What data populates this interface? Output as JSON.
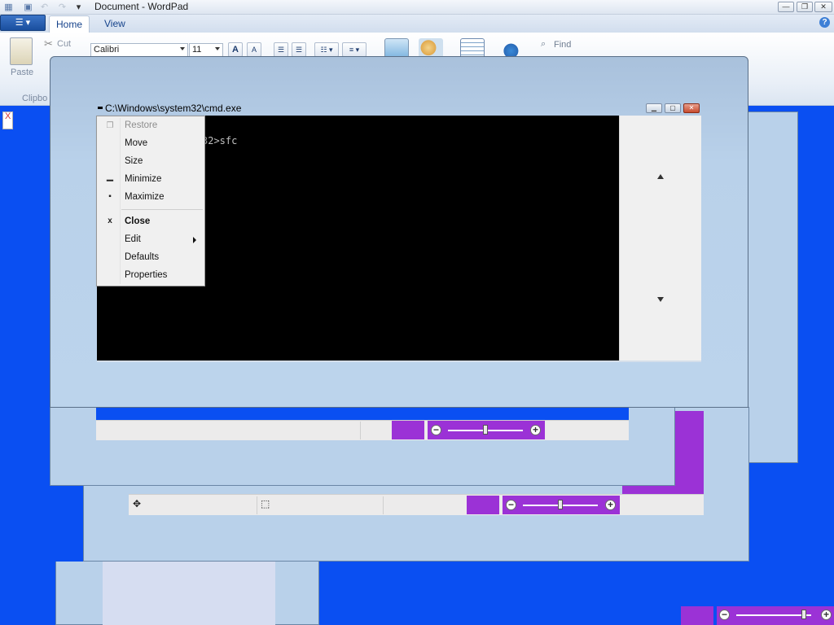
{
  "wordpad": {
    "title": "Document - WordPad",
    "tabs": [
      {
        "label": "Home"
      },
      {
        "label": "View"
      }
    ],
    "app_menu_label": "☰ ▾",
    "help_label": "?",
    "window_controls": {
      "minimize": "—",
      "restore": "❐",
      "close": "✕"
    },
    "clipboard": {
      "paste_label": "Paste",
      "cut_label": "Cut",
      "group_label": "Clipbo"
    },
    "font": {
      "family": "Calibri",
      "size": "11"
    },
    "editing": {
      "find_label": "Find"
    },
    "grow_font_label": "A",
    "shrink_font_label": "A",
    "ruler_mark": "X"
  },
  "cmd": {
    "title": "C:\\Windows\\system32\\cmd.exe",
    "console_text": "32>sfc",
    "controls": {
      "minimize": "▁",
      "maximize": "▢",
      "close": "✕"
    }
  },
  "system_menu": {
    "items": [
      {
        "label": "Restore",
        "icon": "❐",
        "disabled": true
      },
      {
        "label": "Move"
      },
      {
        "label": "Size"
      },
      {
        "label": "Minimize",
        "icon": "▁"
      },
      {
        "label": "Maximize",
        "icon": "▪"
      },
      {
        "label": "Close",
        "icon": "x",
        "bold": true
      },
      {
        "label": "Edit",
        "has_submenu": true
      },
      {
        "label": "Defaults"
      },
      {
        "label": "Properties"
      }
    ]
  },
  "statusbar": {
    "move_icon": "✥",
    "select_icon": "⬚"
  },
  "zoom": {
    "minus": "−",
    "plus": "+"
  },
  "colors": {
    "desktop_blue": "#0a4ff2",
    "zoom_purple": "#9b32d6",
    "window_frame": "#b9d1ea"
  }
}
